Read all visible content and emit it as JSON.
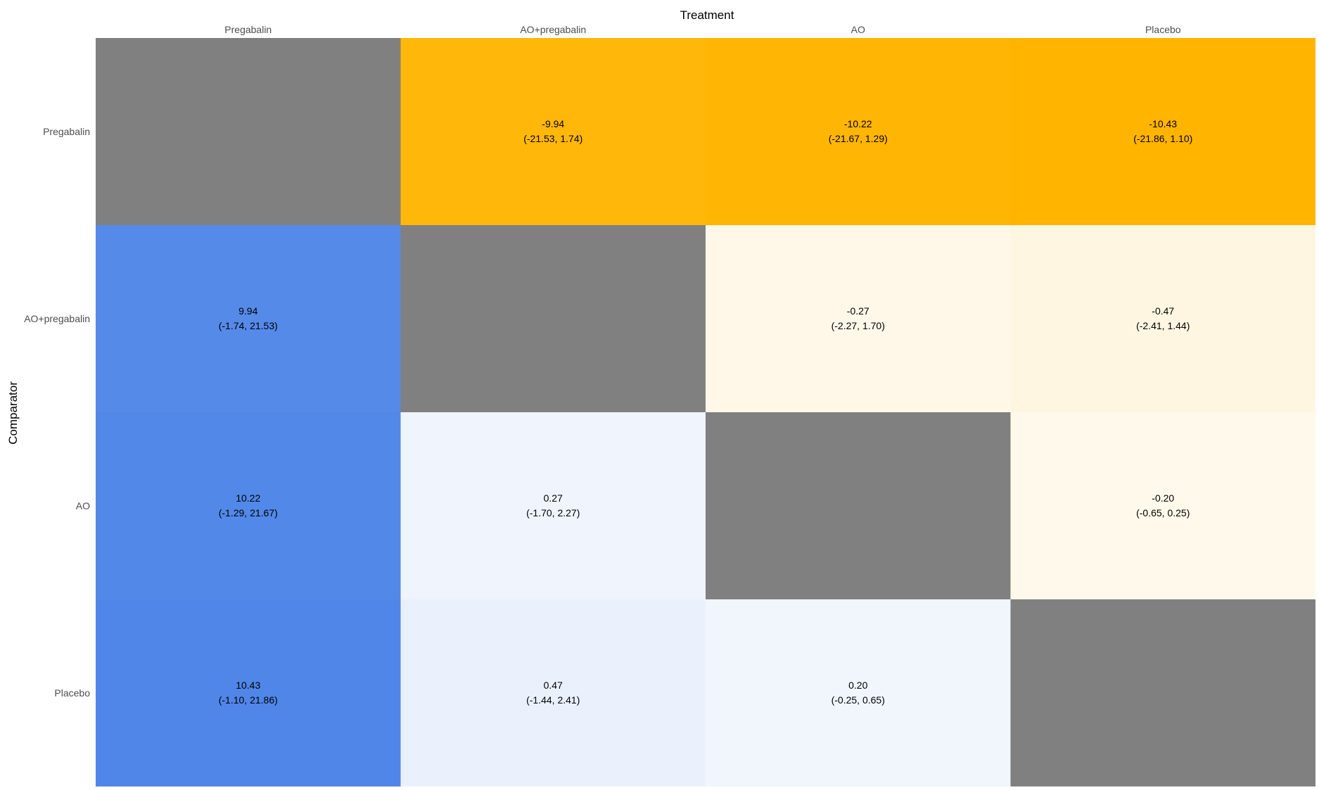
{
  "chart_data": {
    "type": "heatmap",
    "xlabel": "Treatment",
    "ylabel": "Comparator",
    "x_categories": [
      "Pregabalin",
      "AO+pregabalin",
      "AO",
      "Placebo"
    ],
    "y_categories": [
      "Pregabalin",
      "AO+pregabalin",
      "AO",
      "Placebo"
    ],
    "cells": [
      {
        "row": 0,
        "col": 0,
        "estimate": null,
        "label": "",
        "ci": ""
      },
      {
        "row": 0,
        "col": 1,
        "estimate": -9.94,
        "label": "-9.94",
        "ci": "(-21.53, 1.74)"
      },
      {
        "row": 0,
        "col": 2,
        "estimate": -10.22,
        "label": "-10.22",
        "ci": "(-21.67, 1.29)"
      },
      {
        "row": 0,
        "col": 3,
        "estimate": -10.43,
        "label": "-10.43",
        "ci": "(-21.86, 1.10)"
      },
      {
        "row": 1,
        "col": 0,
        "estimate": 9.94,
        "label": "9.94",
        "ci": "(-1.74, 21.53)"
      },
      {
        "row": 1,
        "col": 1,
        "estimate": null,
        "label": "",
        "ci": ""
      },
      {
        "row": 1,
        "col": 2,
        "estimate": -0.27,
        "label": "-0.27",
        "ci": "(-2.27, 1.70)"
      },
      {
        "row": 1,
        "col": 3,
        "estimate": -0.47,
        "label": "-0.47",
        "ci": "(-2.41, 1.44)"
      },
      {
        "row": 2,
        "col": 0,
        "estimate": 10.22,
        "label": "10.22",
        "ci": "(-1.29, 21.67)"
      },
      {
        "row": 2,
        "col": 1,
        "estimate": 0.27,
        "label": "0.27",
        "ci": "(-1.70, 2.27)"
      },
      {
        "row": 2,
        "col": 2,
        "estimate": null,
        "label": "",
        "ci": ""
      },
      {
        "row": 2,
        "col": 3,
        "estimate": -0.2,
        "label": "-0.20",
        "ci": "(-0.65, 0.25)"
      },
      {
        "row": 3,
        "col": 0,
        "estimate": 10.43,
        "label": "10.43",
        "ci": "(-1.10, 21.86)"
      },
      {
        "row": 3,
        "col": 1,
        "estimate": 0.47,
        "label": "0.47",
        "ci": "(-1.44, 2.41)"
      },
      {
        "row": 3,
        "col": 2,
        "estimate": 0.2,
        "label": "0.20",
        "ci": "(-0.25, 0.65)"
      },
      {
        "row": 3,
        "col": 3,
        "estimate": null,
        "label": "",
        "ci": ""
      }
    ],
    "colors": {
      "diagonal": "#808080",
      "negative": "#FFB400",
      "positive": "#4F86E8",
      "neutral": "#FFFFFF"
    },
    "grid": false,
    "legend": "none"
  }
}
